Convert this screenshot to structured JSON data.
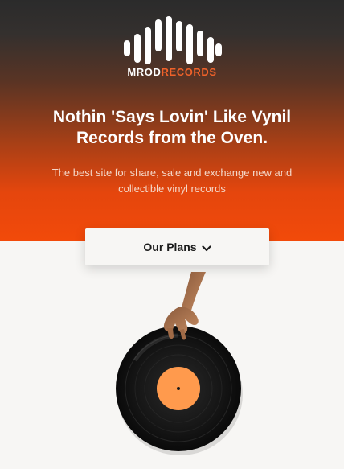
{
  "brand": {
    "name_part1": "MROD",
    "name_part2": "RECORDS"
  },
  "hero": {
    "headline": "Nothin 'Says Lovin' Like Vynil Records from the Oven.",
    "subtitle": "The best site for share, sale and exchange new and collectible vinyl records"
  },
  "plans_button": {
    "label": "Our Plans",
    "icon": "chevron-down-icon"
  },
  "colors": {
    "accent": "#f24a0a",
    "brand_secondary": "#f0622a",
    "record_label": "#ff9a4d",
    "background": "#f7f6f4"
  },
  "illustration": {
    "icon": "vinyl-record-hand-icon"
  }
}
